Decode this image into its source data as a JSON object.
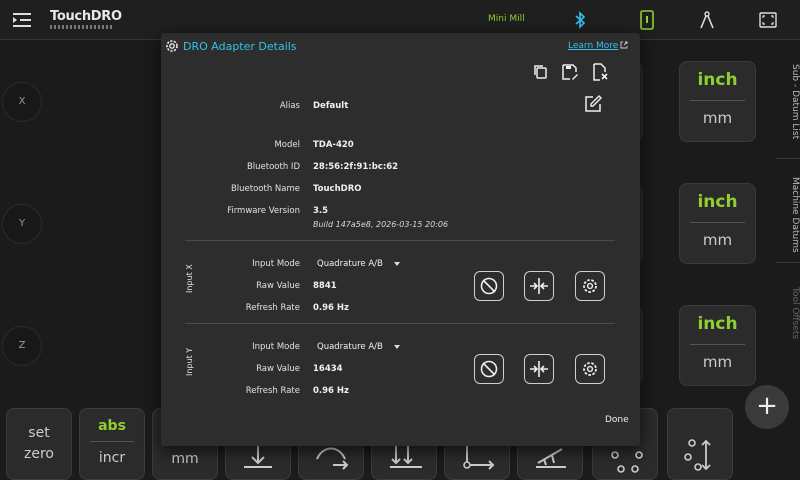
{
  "app": {
    "logo": "TouchDRO",
    "profile": "Mini Mill"
  },
  "icons": {
    "menu": "menu-collapse-icon",
    "bluetooth": "bluetooth-icon",
    "tablet": "tablet-icon",
    "compass": "compass-icon",
    "fullscreen": "fullscreen-icon"
  },
  "colors": {
    "accent_blue": "#2fc4ea",
    "accent_green": "#8fcf2f"
  },
  "dro": {
    "axes": [
      "X",
      "Y",
      "Z"
    ],
    "unit_primary": "inch",
    "unit_secondary": "mm"
  },
  "side_tabs": [
    "Sub - Datum List",
    "Machine Datums",
    "Tool Offsets"
  ],
  "toolbar": {
    "set_zero_line1": "set",
    "set_zero_line2": "zero",
    "abs_label": "abs",
    "incr_label": "incr",
    "mm_label": "mm"
  },
  "fab_label": "+",
  "dialog": {
    "title": "DRO Adapter Details",
    "learn_more": "Learn More",
    "alias_label": "Alias",
    "alias_value": "Default",
    "model_label": "Model",
    "model_value": "TDA-420",
    "bt_id_label": "Bluetooth ID",
    "bt_id_value": "28:56:2f:91:bc:62",
    "bt_name_label": "Bluetooth Name",
    "bt_name_value": "TouchDRO",
    "fw_label": "Firmware Version",
    "fw_value": "3.5",
    "fw_build": "Build 147a5e8, 2026-03-15 20:06",
    "inputs": [
      {
        "group": "Input X",
        "mode_label": "Input Mode",
        "mode_value": "Quadrature A/B",
        "raw_label": "Raw Value",
        "raw_value": "8841",
        "rate_label": "Refresh Rate",
        "rate_value": "0.96 Hz"
      },
      {
        "group": "Input Y",
        "mode_label": "Input Mode",
        "mode_value": "Quadrature A/B",
        "raw_label": "Raw Value",
        "raw_value": "16434",
        "rate_label": "Refresh Rate",
        "rate_value": "0.96 Hz"
      }
    ],
    "done": "Done"
  }
}
